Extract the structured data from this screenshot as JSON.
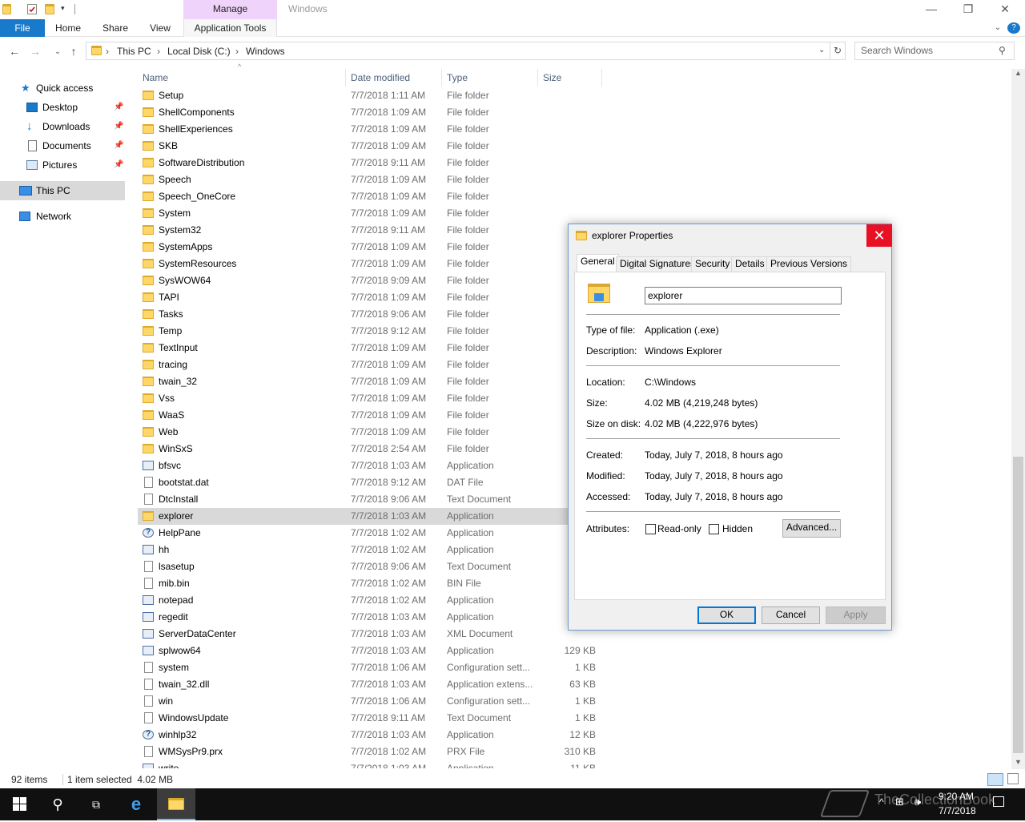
{
  "window": {
    "title": "Windows",
    "manage_label": "Manage",
    "controls": {
      "minimize": "—",
      "maximize": "❐",
      "close": "✕"
    }
  },
  "ribbon": {
    "file": "File",
    "home": "Home",
    "share": "Share",
    "view": "View",
    "app_tools": "Application Tools"
  },
  "address": {
    "crumbs": [
      "This PC",
      "Local Disk (C:)",
      "Windows"
    ],
    "separator": "›",
    "search_placeholder": "Search Windows"
  },
  "nav": {
    "quick_access": "Quick access",
    "desktop": "Desktop",
    "downloads": "Downloads",
    "documents": "Documents",
    "pictures": "Pictures",
    "this_pc": "This PC",
    "network": "Network"
  },
  "columns": {
    "name": "Name",
    "date": "Date modified",
    "type": "Type",
    "size": "Size"
  },
  "files": [
    {
      "name": "Setup",
      "date": "7/7/2018 1:11 AM",
      "type": "File folder",
      "size": "",
      "kind": "folder"
    },
    {
      "name": "ShellComponents",
      "date": "7/7/2018 1:09 AM",
      "type": "File folder",
      "size": "",
      "kind": "folder"
    },
    {
      "name": "ShellExperiences",
      "date": "7/7/2018 1:09 AM",
      "type": "File folder",
      "size": "",
      "kind": "folder"
    },
    {
      "name": "SKB",
      "date": "7/7/2018 1:09 AM",
      "type": "File folder",
      "size": "",
      "kind": "folder"
    },
    {
      "name": "SoftwareDistribution",
      "date": "7/7/2018 9:11 AM",
      "type": "File folder",
      "size": "",
      "kind": "folder"
    },
    {
      "name": "Speech",
      "date": "7/7/2018 1:09 AM",
      "type": "File folder",
      "size": "",
      "kind": "folder"
    },
    {
      "name": "Speech_OneCore",
      "date": "7/7/2018 1:09 AM",
      "type": "File folder",
      "size": "",
      "kind": "folder"
    },
    {
      "name": "System",
      "date": "7/7/2018 1:09 AM",
      "type": "File folder",
      "size": "",
      "kind": "folder"
    },
    {
      "name": "System32",
      "date": "7/7/2018 9:11 AM",
      "type": "File folder",
      "size": "",
      "kind": "folder"
    },
    {
      "name": "SystemApps",
      "date": "7/7/2018 1:09 AM",
      "type": "File folder",
      "size": "",
      "kind": "folder"
    },
    {
      "name": "SystemResources",
      "date": "7/7/2018 1:09 AM",
      "type": "File folder",
      "size": "",
      "kind": "folder"
    },
    {
      "name": "SysWOW64",
      "date": "7/7/2018 9:09 AM",
      "type": "File folder",
      "size": "",
      "kind": "folder"
    },
    {
      "name": "TAPI",
      "date": "7/7/2018 1:09 AM",
      "type": "File folder",
      "size": "",
      "kind": "folder"
    },
    {
      "name": "Tasks",
      "date": "7/7/2018 9:06 AM",
      "type": "File folder",
      "size": "",
      "kind": "folder"
    },
    {
      "name": "Temp",
      "date": "7/7/2018 9:12 AM",
      "type": "File folder",
      "size": "",
      "kind": "folder"
    },
    {
      "name": "TextInput",
      "date": "7/7/2018 1:09 AM",
      "type": "File folder",
      "size": "",
      "kind": "folder"
    },
    {
      "name": "tracing",
      "date": "7/7/2018 1:09 AM",
      "type": "File folder",
      "size": "",
      "kind": "folder"
    },
    {
      "name": "twain_32",
      "date": "7/7/2018 1:09 AM",
      "type": "File folder",
      "size": "",
      "kind": "folder"
    },
    {
      "name": "Vss",
      "date": "7/7/2018 1:09 AM",
      "type": "File folder",
      "size": "",
      "kind": "folder"
    },
    {
      "name": "WaaS",
      "date": "7/7/2018 1:09 AM",
      "type": "File folder",
      "size": "",
      "kind": "folder"
    },
    {
      "name": "Web",
      "date": "7/7/2018 1:09 AM",
      "type": "File folder",
      "size": "",
      "kind": "folder"
    },
    {
      "name": "WinSxS",
      "date": "7/7/2018 2:54 AM",
      "type": "File folder",
      "size": "",
      "kind": "folder"
    },
    {
      "name": "bfsvc",
      "date": "7/7/2018 1:03 AM",
      "type": "Application",
      "size": "",
      "kind": "app"
    },
    {
      "name": "bootstat.dat",
      "date": "7/7/2018 9:12 AM",
      "type": "DAT File",
      "size": "",
      "kind": "doc"
    },
    {
      "name": "DtcInstall",
      "date": "7/7/2018 9:06 AM",
      "type": "Text Document",
      "size": "",
      "kind": "doc"
    },
    {
      "name": "explorer",
      "date": "7/7/2018 1:03 AM",
      "type": "Application",
      "size": "4,",
      "kind": "folderapp",
      "selected": true
    },
    {
      "name": "HelpPane",
      "date": "7/7/2018 1:02 AM",
      "type": "Application",
      "size": "1,",
      "kind": "help"
    },
    {
      "name": "hh",
      "date": "7/7/2018 1:02 AM",
      "type": "Application",
      "size": "",
      "kind": "app"
    },
    {
      "name": "lsasetup",
      "date": "7/7/2018 9:06 AM",
      "type": "Text Document",
      "size": "",
      "kind": "doc"
    },
    {
      "name": "mib.bin",
      "date": "7/7/2018 1:02 AM",
      "type": "BIN File",
      "size": "",
      "kind": "doc"
    },
    {
      "name": "notepad",
      "date": "7/7/2018 1:02 AM",
      "type": "Application",
      "size": "",
      "kind": "app"
    },
    {
      "name": "regedit",
      "date": "7/7/2018 1:03 AM",
      "type": "Application",
      "size": "",
      "kind": "app"
    },
    {
      "name": "ServerDataCenter",
      "date": "7/7/2018 1:03 AM",
      "type": "XML Document",
      "size": "",
      "kind": "app"
    },
    {
      "name": "splwow64",
      "date": "7/7/2018 1:03 AM",
      "type": "Application",
      "size": "129 KB",
      "kind": "app"
    },
    {
      "name": "system",
      "date": "7/7/2018 1:06 AM",
      "type": "Configuration sett...",
      "size": "1 KB",
      "kind": "doc"
    },
    {
      "name": "twain_32.dll",
      "date": "7/7/2018 1:03 AM",
      "type": "Application extens...",
      "size": "63 KB",
      "kind": "doc"
    },
    {
      "name": "win",
      "date": "7/7/2018 1:06 AM",
      "type": "Configuration sett...",
      "size": "1 KB",
      "kind": "doc"
    },
    {
      "name": "WindowsUpdate",
      "date": "7/7/2018 9:11 AM",
      "type": "Text Document",
      "size": "1 KB",
      "kind": "doc"
    },
    {
      "name": "winhlp32",
      "date": "7/7/2018 1:03 AM",
      "type": "Application",
      "size": "12 KB",
      "kind": "help"
    },
    {
      "name": "WMSysPr9.prx",
      "date": "7/7/2018 1:02 AM",
      "type": "PRX File",
      "size": "310 KB",
      "kind": "doc"
    },
    {
      "name": "write",
      "date": "7/7/2018 1:03 AM",
      "type": "Application",
      "size": "11 KB",
      "kind": "app"
    }
  ],
  "status": {
    "count": "92 items",
    "selected": "1 item selected  4.02 MB"
  },
  "dialog": {
    "title": "explorer Properties",
    "tabs": [
      "General",
      "Digital Signatures",
      "Security",
      "Details",
      "Previous Versions"
    ],
    "name_value": "explorer",
    "type_label": "Type of file:",
    "type_value": "Application (.exe)",
    "desc_label": "Description:",
    "desc_value": "Windows Explorer",
    "loc_label": "Location:",
    "loc_value": "C:\\Windows",
    "size_label": "Size:",
    "size_value": "4.02 MB (4,219,248 bytes)",
    "sod_label": "Size on disk:",
    "sod_value": "4.02 MB (4,222,976 bytes)",
    "created_label": "Created:",
    "created_value": "Today, July 7, 2018, 8 hours ago",
    "modified_label": "Modified:",
    "modified_value": "Today, July 7, 2018, 8 hours ago",
    "accessed_label": "Accessed:",
    "accessed_value": "Today, July 7, 2018, 8 hours ago",
    "attr_label": "Attributes:",
    "readonly": "Read-only",
    "hidden": "Hidden",
    "advanced": "Advanced...",
    "ok": "OK",
    "cancel": "Cancel",
    "apply": "Apply"
  },
  "taskbar": {
    "time": "9:20 AM",
    "date": "7/7/2018",
    "watermark": "TheCollectionBook"
  },
  "colors": {
    "accent": "#1979ca",
    "manage": "#f0d3fa",
    "close": "#e81123",
    "selection": "#d9d9d9"
  }
}
